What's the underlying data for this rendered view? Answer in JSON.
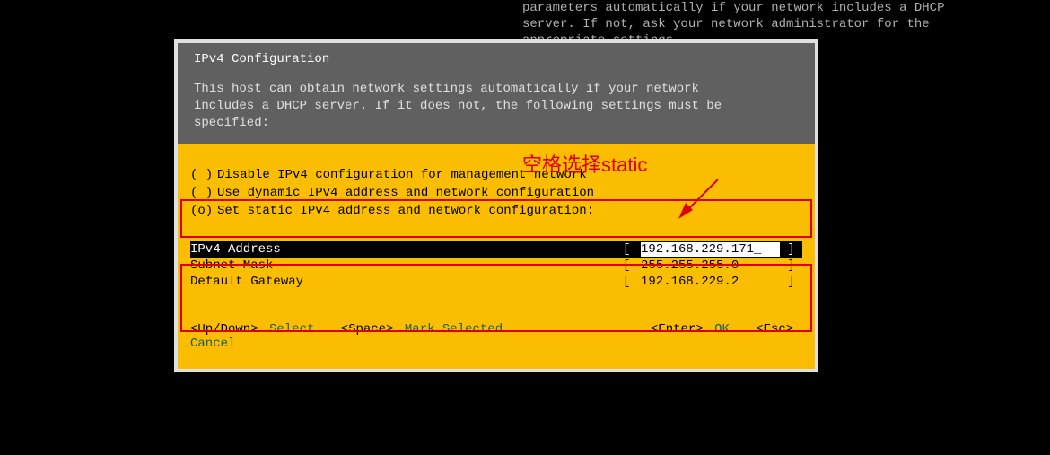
{
  "background_text": "parameters automatically if your network includes a DHCP\nserver. If not, ask your network administrator for the\nappropriate settings.",
  "dialog": {
    "title": "IPv4 Configuration",
    "description": "This host can obtain network settings automatically if your network\nincludes a DHCP server. If it does not, the following settings must be\nspecified:",
    "options": [
      {
        "mark": "( )",
        "label": "Disable IPv4 configuration for management network"
      },
      {
        "mark": "( )",
        "label": "Use dynamic IPv4 address and network configuration"
      },
      {
        "mark": "(o)",
        "label": "Set static IPv4 address and network configuration:"
      }
    ],
    "fields": [
      {
        "label": "IPv4 Address",
        "value": "192.168.229.171_",
        "selected": true
      },
      {
        "label": "Subnet Mask",
        "value": "255.255.255.0",
        "selected": false
      },
      {
        "label": "Default Gateway",
        "value": "192.168.229.2",
        "selected": false
      }
    ],
    "footer": {
      "updown_key": "<Up/Down>",
      "updown_action": "Select",
      "space_key": "<Space>",
      "space_action": "Mark Selected",
      "enter_key": "<Enter>",
      "enter_action": "OK",
      "esc_key": "<Esc>",
      "esc_action": "Cancel"
    }
  },
  "annotation": "空格选择static"
}
